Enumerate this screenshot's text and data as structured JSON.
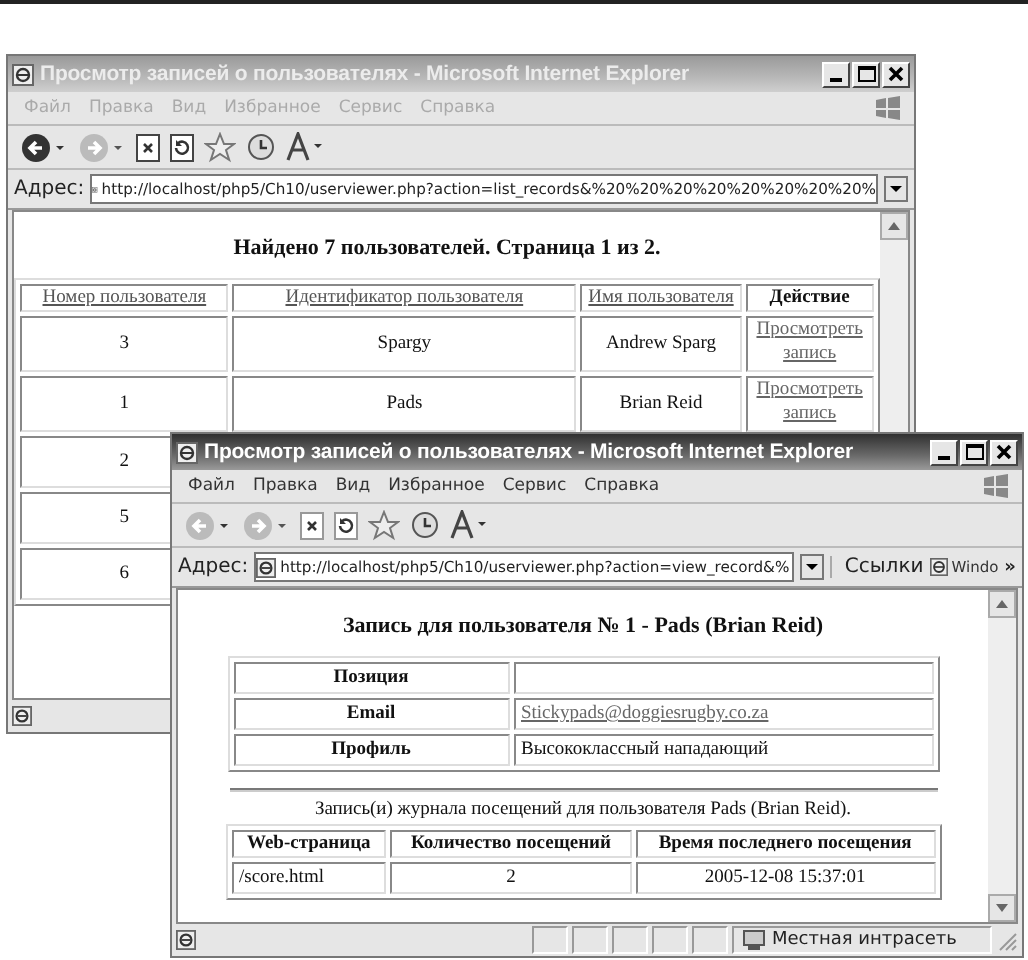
{
  "windows": [
    {
      "title": "Просмотр записей о пользователях - Microsoft Internet Explorer",
      "active": false,
      "menu": [
        "Файл",
        "Правка",
        "Вид",
        "Избранное",
        "Сервис",
        "Справка"
      ],
      "address_label": "Адрес:",
      "address": "http://localhost/php5/Ch10/userviewer.php?action=list_records&%20%20%20%20%20%20%20%20%",
      "page": {
        "kind": "list",
        "heading": "Найдено 7 пользователей. Страница 1 из 2.",
        "columns": [
          {
            "label": "Номер пользователя",
            "link": true
          },
          {
            "label": "Идентификатор пользователя",
            "link": true
          },
          {
            "label": "Имя пользователя",
            "link": true
          },
          {
            "label": "Действие",
            "link": false
          }
        ],
        "rows": [
          {
            "cells": [
              "3",
              "Spargy",
              "Andrew Sparg"
            ],
            "action": "Просмотреть запись"
          },
          {
            "cells": [
              "1",
              "Pads",
              "Brian Reid"
            ],
            "action": "Просмотреть запись"
          },
          {
            "cells": [
              "2"
            ]
          },
          {
            "cells": [
              "5"
            ]
          },
          {
            "cells": [
              "6"
            ]
          }
        ]
      }
    },
    {
      "title": "Просмотр записей о пользователях - Microsoft Internet Explorer",
      "active": true,
      "menu": [
        "Файл",
        "Правка",
        "Вид",
        "Избранное",
        "Сервис",
        "Справка"
      ],
      "address_label": "Адрес:",
      "address": "http://localhost/php5/Ch10/userviewer.php?action=view_record&%",
      "links_label": "Ссылки",
      "links": [
        "Windo"
      ],
      "more": "»",
      "zone": "Местная интрасеть",
      "page": {
        "kind": "record",
        "heading": "Запись для пользователя № 1 - Pads (Brian Reid)",
        "fields": [
          {
            "label": "Позиция"
          },
          {
            "label": "Email",
            "value": "Stickypads@doggiesrugby.co.za",
            "link": true
          },
          {
            "label": "Профиль",
            "value": "Высококлассный нападающий",
            "link": false
          }
        ],
        "caption": "Запись(и) журнала посещений для пользователя Pads (Brian Reid).",
        "columns": [
          "Web-страница",
          "Количество посещений",
          "Время последнего посещения"
        ],
        "rows": [
          [
            "/score.html",
            "2",
            "2005-12-08 15:37:01"
          ]
        ]
      }
    }
  ]
}
